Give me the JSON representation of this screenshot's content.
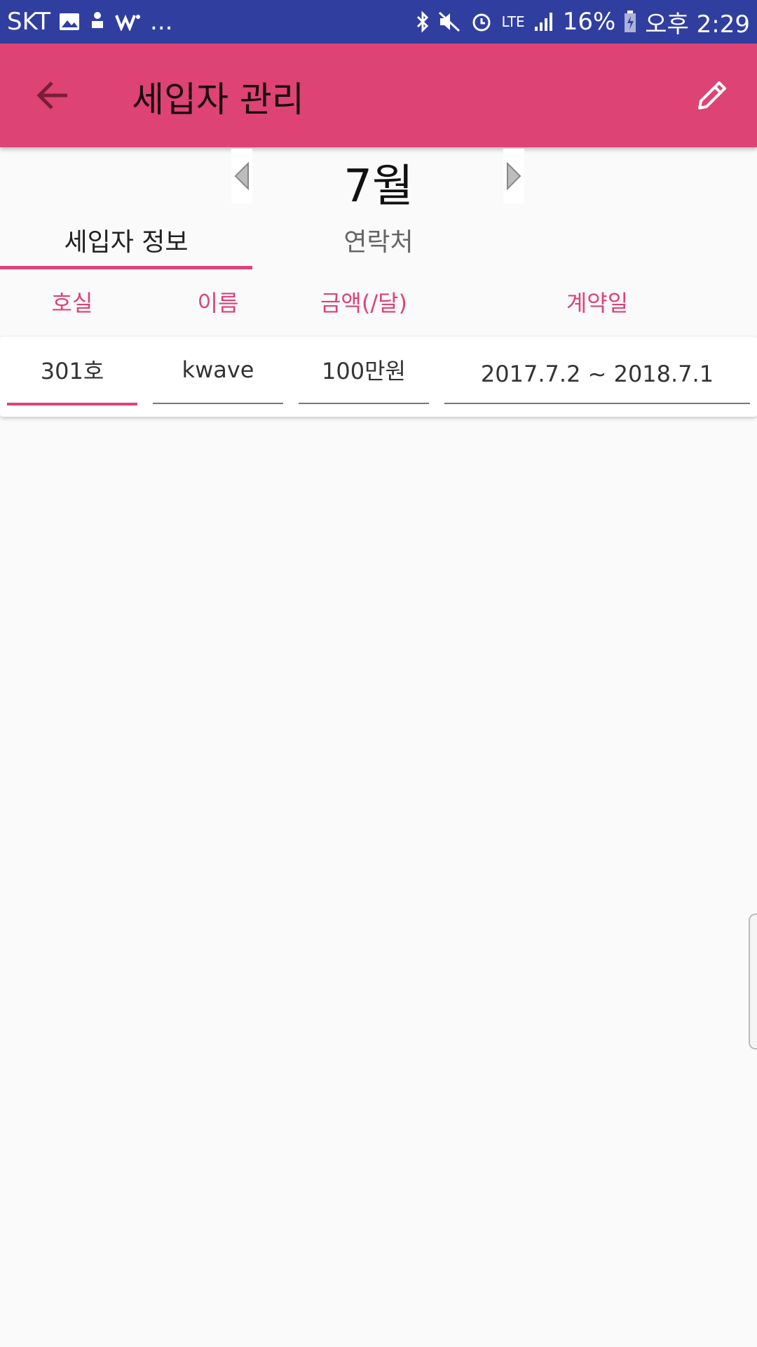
{
  "status_bar": {
    "carrier": "SKT",
    "extra": "...",
    "network": "LTE",
    "battery": "16%",
    "time": "오후 2:29"
  },
  "app_bar": {
    "title": "세입자 관리"
  },
  "month_nav": {
    "label": "7월"
  },
  "tabs": [
    {
      "label": "세입자 정보",
      "selected": true
    },
    {
      "label": "연락처",
      "selected": false
    }
  ],
  "table": {
    "headers": [
      "호실",
      "이름",
      "금액(/달)",
      "계약일"
    ],
    "rows": [
      {
        "room": "301호",
        "name": "kwave",
        "amount": "100만원",
        "contract": "2017.7.2 ~ 2018.7.1"
      }
    ]
  },
  "colors": {
    "accent": "#de4375",
    "status_bar": "#303f9f",
    "background": "#fafafa"
  }
}
